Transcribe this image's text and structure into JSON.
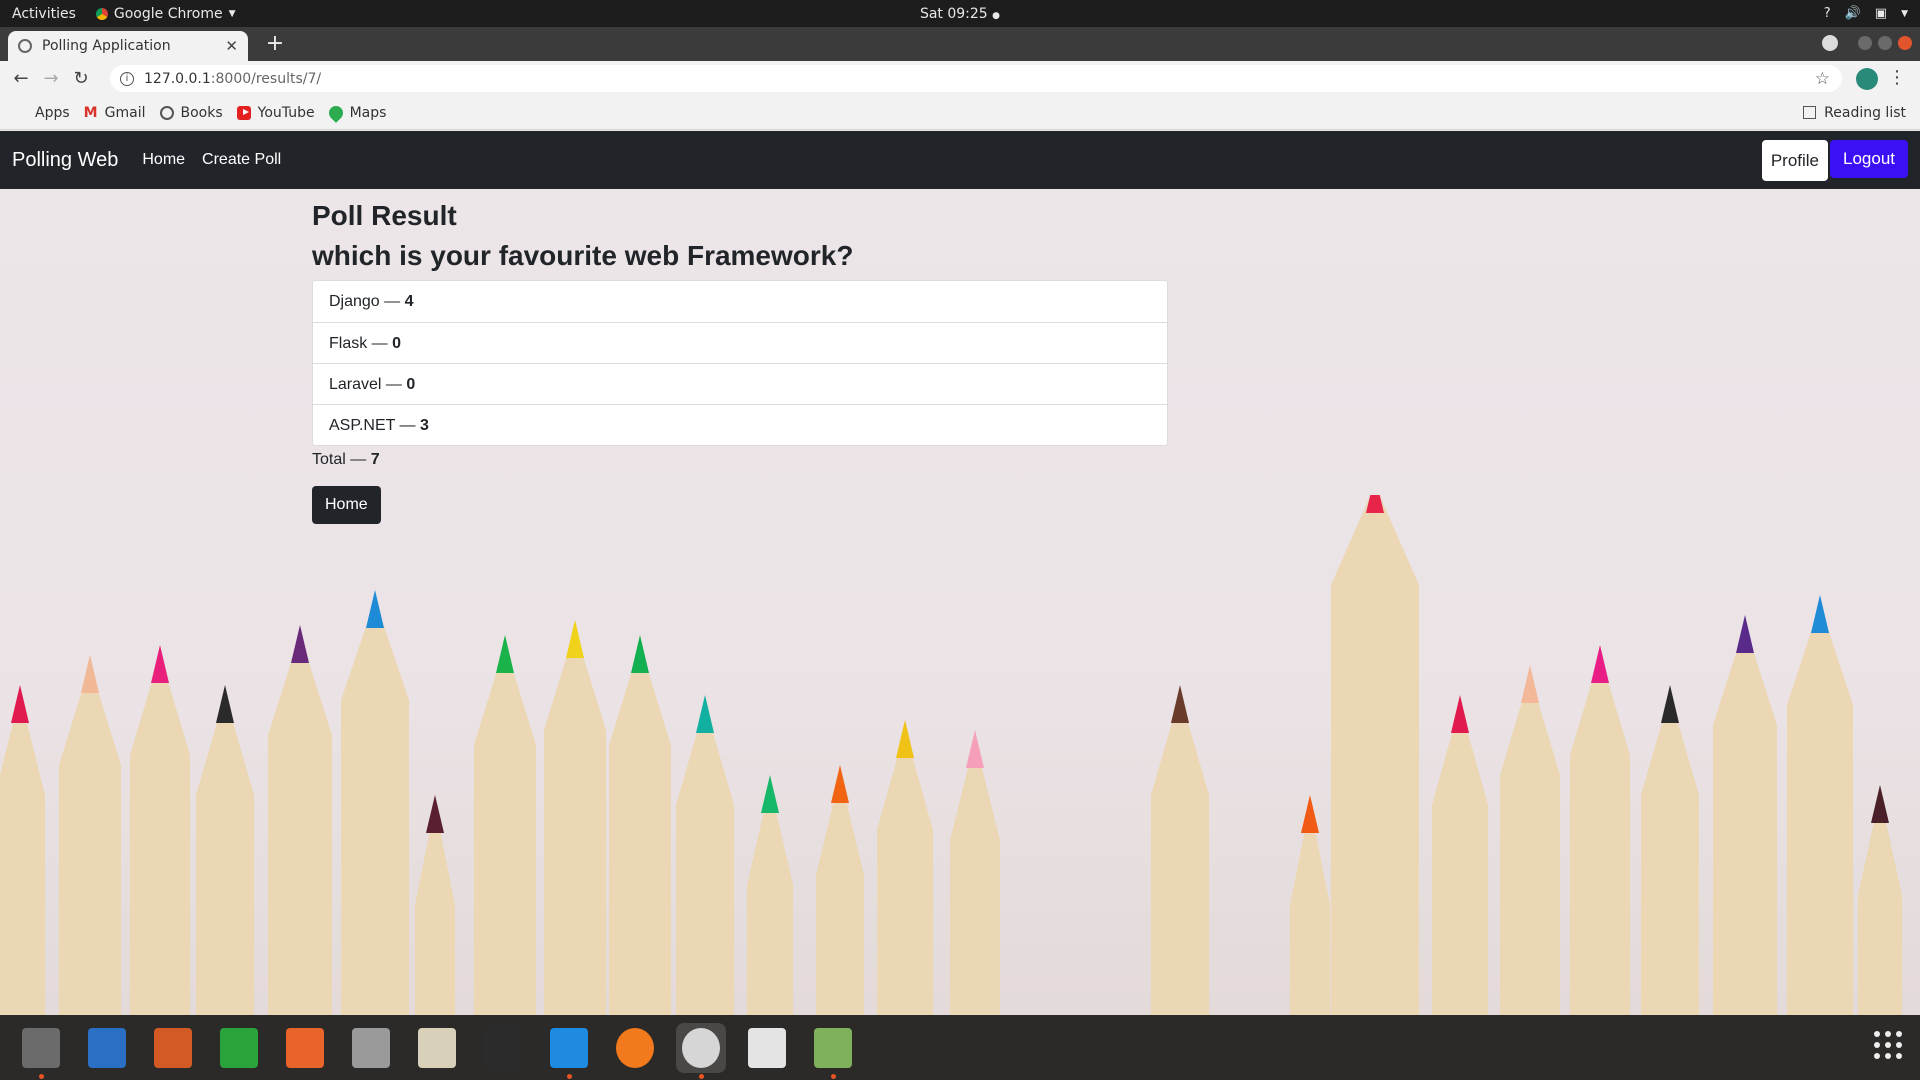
{
  "topbar": {
    "activities": "Activities",
    "app_menu": "Google Chrome",
    "clock": "Sat 09:25"
  },
  "browser": {
    "tab_title": "Polling Application",
    "url_host": "127.0.0.1",
    "url_rest": ":8000/results/7/",
    "bookmarks": [
      "Apps",
      "Gmail",
      "Books",
      "YouTube",
      "Maps"
    ],
    "reading_list": "Reading list"
  },
  "app": {
    "brand": "Polling Web",
    "nav": [
      "Home",
      "Create Poll"
    ],
    "profile_label": "Profile",
    "logout_label": "Logout"
  },
  "poll": {
    "heading": "Poll Result",
    "question": "which is your favourite web Framework?",
    "choices": [
      {
        "label": "Django",
        "votes": "4"
      },
      {
        "label": "Flask",
        "votes": "0"
      },
      {
        "label": "Laravel",
        "votes": "0"
      },
      {
        "label": "ASP.NET",
        "votes": "3"
      }
    ],
    "total_label": "Total",
    "total": "7",
    "home_button": "Home"
  },
  "dock": {
    "apps": [
      "files-icon",
      "writer-icon",
      "impress-icon",
      "calc-icon",
      "software-icon",
      "settings-icon",
      "text-editor-icon",
      "terminal-icon",
      "vscode-icon",
      "firefox-icon",
      "chrome-icon",
      "evince-icon",
      "image-viewer-icon"
    ],
    "colors": [
      "#6b6b6b",
      "#2a6fc4",
      "#d35a25",
      "#2aa33a",
      "#e8642b",
      "#9a9a9a",
      "#d8d0b8",
      "#2b2b2b",
      "#1f8be0",
      "#f27a1d",
      "#d6d6d6",
      "#e4e4e4",
      "#7fb05a"
    ]
  }
}
